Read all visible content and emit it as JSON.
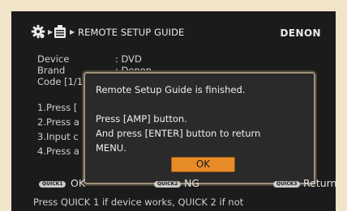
{
  "header": {
    "title": "REMOTE SETUP GUIDE",
    "brand": "DENON"
  },
  "info": [
    {
      "key": "Device",
      "value": ": DVD"
    },
    {
      "key": "Brand",
      "value": ": Denon"
    },
    {
      "key": "Code [1/1]",
      "value": ""
    }
  ],
  "steps": [
    "1.Press [",
    "2.Press a",
    "3.Input c",
    "4.Press a"
  ],
  "dialog": {
    "line1": "Remote Setup Guide is finished.",
    "line2": "Press [AMP] button.",
    "line3": "And press [ENTER] button to return",
    "line4": "MENU.",
    "ok_label": "OK"
  },
  "buttons": {
    "quick1_badge": "QUICK1",
    "quick1_label": "OK",
    "quick2_badge": "QUICK2",
    "quick2_label": "NG",
    "quick3_badge": "QUICK3",
    "quick3_label": "Return"
  },
  "instruction": "Press QUICK 1 if device works, QUICK 2 if not"
}
